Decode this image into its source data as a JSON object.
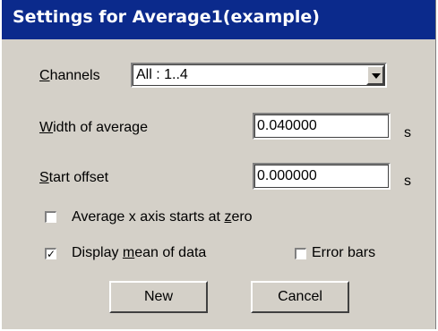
{
  "dialog": {
    "title": "Settings for Average1(example)",
    "channels": {
      "label_before": "",
      "label_underlined": "C",
      "label_after": "hannels",
      "selected_value": "All : 1..4"
    },
    "width_of_average": {
      "label_underlined": "W",
      "label_after": "idth of average",
      "value": "0.040000",
      "unit": "s"
    },
    "start_offset": {
      "label_underlined": "S",
      "label_after": "tart offset",
      "value": "0.000000",
      "unit": "s"
    },
    "average_zero": {
      "label_before": "Average x axis starts at ",
      "label_underlined": "z",
      "label_after": "ero",
      "checked": false
    },
    "display_mean": {
      "label_before": "Display ",
      "label_underlined": "m",
      "label_after": "ean of data",
      "checked": true,
      "check_glyph": "✓"
    },
    "error_bars": {
      "label": "Error bars",
      "checked": false
    },
    "buttons": {
      "new_label": "New",
      "cancel_label": "Cancel"
    }
  }
}
